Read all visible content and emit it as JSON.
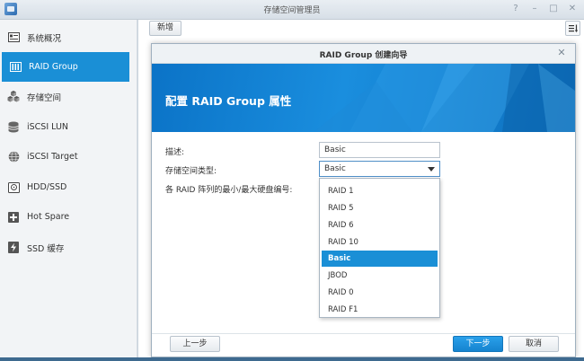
{
  "window": {
    "title": "存储空间管理员",
    "controls": [
      "help-icon",
      "minimize-icon",
      "maximize-icon",
      "close-icon"
    ]
  },
  "sidebar": {
    "items": [
      {
        "label": "系统概况",
        "icon": "overview-icon"
      },
      {
        "label": "RAID Group",
        "icon": "raid-icon",
        "active": true
      },
      {
        "label": "存储空间",
        "icon": "storage-cubes-icon"
      },
      {
        "label": "iSCSI LUN",
        "icon": "disk-stack-icon"
      },
      {
        "label": "iSCSI Target",
        "icon": "globe-icon"
      },
      {
        "label": "HDD/SSD",
        "icon": "hdd-icon"
      },
      {
        "label": "Hot Spare",
        "icon": "plus-box-icon"
      },
      {
        "label": "SSD 缓存",
        "icon": "lightning-icon"
      }
    ]
  },
  "toolbar": {
    "new_label": "新增",
    "sort_icon": "sort-icon"
  },
  "dialog": {
    "title": "RAID Group 创建向导",
    "banner_title": "配置 RAID Group 属性",
    "form": {
      "description_label": "描述:",
      "description_value": "Basic",
      "type_label": "存储空间类型:",
      "type_value": "Basic",
      "disk_label": "各 RAID 阵列的最小/最大硬盘编号:"
    },
    "dropdown_options": [
      "RAID 1",
      "RAID 5",
      "RAID 6",
      "RAID 10",
      "Basic",
      "JBOD",
      "RAID 0",
      "RAID F1"
    ],
    "selected_option": "Basic",
    "buttons": {
      "back": "上一步",
      "next": "下一步",
      "cancel": "取消"
    }
  },
  "colors": {
    "accent": "#1a8fd6",
    "banner": "#0b73c7",
    "sidebar_bg": "#f2f4f6"
  }
}
